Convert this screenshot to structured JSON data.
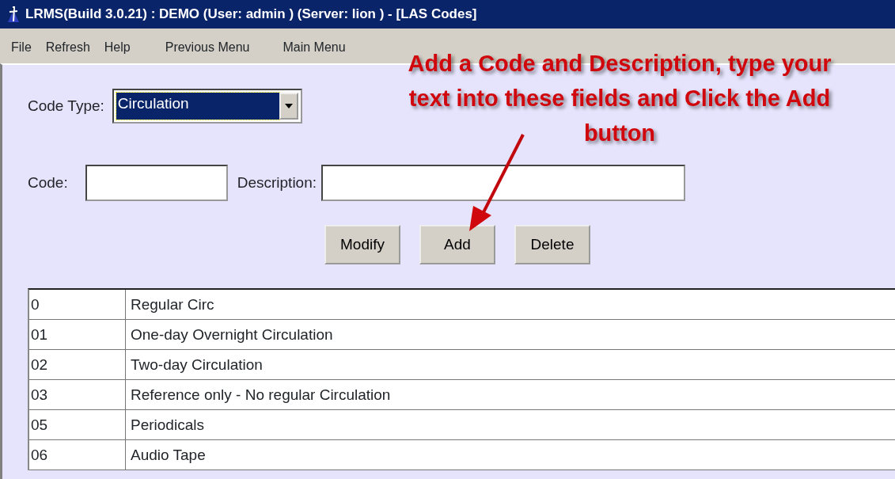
{
  "window": {
    "title": "LRMS(Build 3.0.21) : DEMO (User: admin ) (Server: lion ) - [LAS Codes]"
  },
  "menu": [
    "File",
    "Refresh",
    "Help",
    "Previous Menu",
    "Main Menu"
  ],
  "code_type": {
    "label": "Code Type:",
    "value": "Circulation"
  },
  "code": {
    "label": "Code:"
  },
  "description": {
    "label": "Description:"
  },
  "buttons": [
    "Modify",
    "Add",
    "Delete"
  ],
  "rows": [
    {
      "code": "0",
      "description": "Regular Circ"
    },
    {
      "code": "01",
      "description": "One-day Overnight Circulation"
    },
    {
      "code": "02",
      "description": "Two-day Circulation"
    },
    {
      "code": "03",
      "description": "Reference only - No regular Circulation"
    },
    {
      "code": "05",
      "description": "Periodicals"
    },
    {
      "code": "06",
      "description": "Audio Tape"
    }
  ],
  "annotation": "Add a Code and Description, type your text into these fields and Click the Add button"
}
